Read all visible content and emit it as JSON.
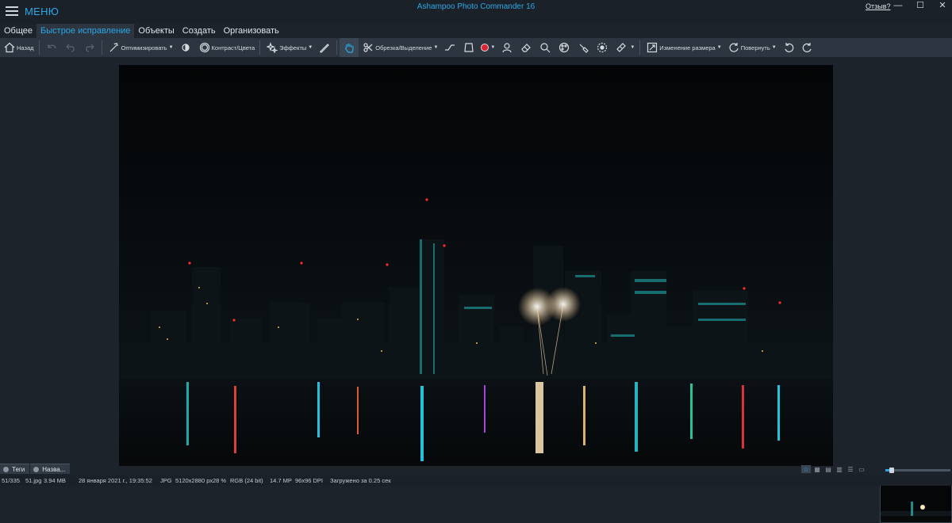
{
  "titlebar": {
    "menu_label": "МЕНЮ",
    "app_title": "Ashampoo Photo Commander 16",
    "feedback_link": "Отзыв?",
    "minimize": "—",
    "maximize": "☐",
    "close": "✕"
  },
  "tabs": [
    {
      "label": "Общее",
      "active": false
    },
    {
      "label": "Быстрое исправление",
      "active": true
    },
    {
      "label": "Объекты",
      "active": false
    },
    {
      "label": "Создать",
      "active": false
    },
    {
      "label": "Организовать",
      "active": false
    }
  ],
  "toolbar": {
    "back_label": "Назад",
    "optimize_label": "Оптимизировать",
    "contrast_label": "Контраст/Цвета",
    "effects_label": "Эффекты",
    "crop_label": "Обрезка/Выделение",
    "resize_label": "Изменение размера",
    "rotate_label": "Повернуть",
    "icons": [
      "home-icon",
      "undo-all-icon",
      "undo-icon",
      "redo-icon",
      "magic-wand-icon",
      "brightness-icon",
      "contrast-icon",
      "effects-stars-icon",
      "pen-icon",
      "hand-icon",
      "scissors-icon",
      "straighten-icon",
      "perspective-icon",
      "red-eye-icon",
      "retouch-icon",
      "eraser-icon",
      "clone-icon",
      "color-palette-icon",
      "brush-icon",
      "focus-icon",
      "bandage-icon",
      "resize-icon",
      "rotate-icon",
      "rotate-left-icon",
      "rotate-right-icon"
    ]
  },
  "bottom_tabs": {
    "tags_label": "Теги",
    "name_label": "Назва..."
  },
  "status": {
    "index": "51/335",
    "filename": "51.jpg",
    "filesize": "3.94 MB",
    "date": "28 января 2021 г., 19:35:52",
    "format": "JPG",
    "dimensions": "5120x2880 px",
    "zoom": "28 %",
    "color": "RGB (24 bit)",
    "megapixels": "14.7 MP",
    "dpi": "96x96 DPI",
    "load_time": "Загружено за 0.25 сек"
  },
  "zoom_level": 0.1,
  "colors": {
    "accent": "#2aa8e6",
    "background": "#1d232b",
    "toolbar": "#2c3540",
    "red_eye": "#e0212f"
  }
}
